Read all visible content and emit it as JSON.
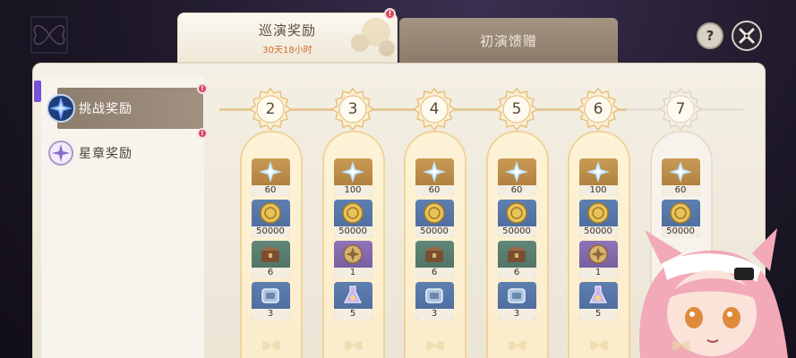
{
  "tabs": [
    {
      "label": "巡演奖励",
      "sub": "30天18小时",
      "active": true,
      "badge": "!"
    },
    {
      "label": "初演馈赠",
      "active": false
    }
  ],
  "header": {
    "help_label": "?"
  },
  "sidebar": {
    "items": [
      {
        "label": "挑战奖励",
        "active": true,
        "badge": "!"
      },
      {
        "label": "星章奖励",
        "active": false,
        "badge": "!"
      }
    ]
  },
  "days": [
    {
      "day": "2",
      "rewards": [
        {
          "icon": "primogem-icon",
          "qty": "60"
        },
        {
          "icon": "mora-coin-icon",
          "qty": "50000"
        },
        {
          "icon": "chest-icon",
          "qty": "6"
        },
        {
          "icon": "enhancement-ore-icon",
          "qty": "3"
        }
      ]
    },
    {
      "day": "3",
      "rewards": [
        {
          "icon": "primogem-icon",
          "qty": "100"
        },
        {
          "icon": "mora-coin-icon",
          "qty": "50000"
        },
        {
          "icon": "hero-wit-icon",
          "qty": "1"
        },
        {
          "icon": "crystal-flask-icon",
          "qty": "5"
        }
      ]
    },
    {
      "day": "4",
      "rewards": [
        {
          "icon": "primogem-icon",
          "qty": "60"
        },
        {
          "icon": "mora-coin-icon",
          "qty": "50000"
        },
        {
          "icon": "chest-icon",
          "qty": "6"
        },
        {
          "icon": "enhancement-ore-icon",
          "qty": "3"
        }
      ]
    },
    {
      "day": "5",
      "rewards": [
        {
          "icon": "primogem-icon",
          "qty": "60"
        },
        {
          "icon": "mora-coin-icon",
          "qty": "50000"
        },
        {
          "icon": "chest-icon",
          "qty": "6"
        },
        {
          "icon": "enhancement-ore-icon",
          "qty": "3"
        }
      ]
    },
    {
      "day": "6",
      "rewards": [
        {
          "icon": "primogem-icon",
          "qty": "100"
        },
        {
          "icon": "mora-coin-icon",
          "qty": "50000"
        },
        {
          "icon": "hero-wit-icon",
          "qty": "1"
        },
        {
          "icon": "crystal-flask-icon",
          "qty": "5"
        }
      ]
    },
    {
      "day": "7",
      "rewards": [
        {
          "icon": "primogem-icon",
          "qty": "60"
        },
        {
          "icon": "mora-coin-icon",
          "qty": "50000"
        }
      ]
    }
  ],
  "colors": {
    "panel": "#f4efe4",
    "tab_active": "#fbf8f0",
    "tab_inactive": "#9a8a78",
    "highlight_border": "#efd49a",
    "badge_red": "#d9455c",
    "countdown": "#d06a28"
  }
}
